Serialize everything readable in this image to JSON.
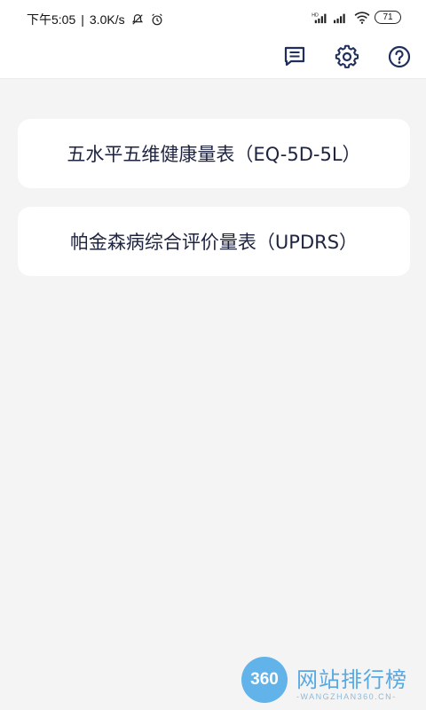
{
  "status_bar": {
    "time": "下午5:05",
    "network_speed": "3.0K/s",
    "battery_level": "71",
    "icons": [
      "muted-notification-icon",
      "alarm-icon",
      "hd-signal-icon",
      "signal-icon",
      "wifi-icon",
      "battery-icon"
    ]
  },
  "toolbar": {
    "icons": [
      "message-icon",
      "gear-icon",
      "help-icon"
    ],
    "icon_color": "#1f2f5c"
  },
  "scales": [
    {
      "label": "五水平五维健康量表（EQ-5D-5L）"
    },
    {
      "label": "帕金森病综合评价量表（UPDRS）"
    }
  ],
  "watermark": {
    "logo_text": "360",
    "title": "网站排行榜",
    "subtitle": "-WANGZHAN360.CN-"
  },
  "colors": {
    "background": "#f4f4f5",
    "card": "#ffffff",
    "text": "#1e2340",
    "watermark_blue": "#3d9bdf"
  }
}
